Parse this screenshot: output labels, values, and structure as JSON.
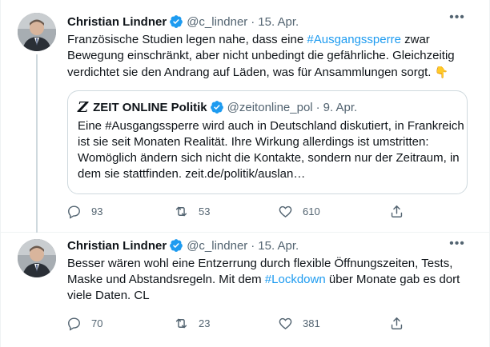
{
  "tweets": [
    {
      "author": "Christian Lindner",
      "handle": "@c_lindner",
      "separator": "·",
      "date": "15. Apr.",
      "lines": [
        {
          "pre": "Französische Studien legen nahe, dass eine ",
          "tag": "#Ausgangssperre",
          "post": " zwar"
        },
        {
          "pre": "Bewegung einschränkt, aber nicht unbedingt die gefährliche. Gleichzeitig",
          "tag": "",
          "post": ""
        },
        {
          "pre": "verdichtet sie den Andrang auf Läden, was für Ansammlungen sorgt. ",
          "tag": "",
          "post": "👇"
        }
      ],
      "quote": {
        "logo": "Z",
        "author": "ZEIT ONLINE Politik",
        "handle": "@zeitonline_pol",
        "date": "9. Apr.",
        "lines": [
          "Eine #Ausgangssperre wird auch in Deutschland diskutiert, in Frankreich",
          "ist sie seit Monaten Realität. Ihre Wirkung allerdings ist umstritten:",
          "Womöglich ändern sich nicht die Kontakte, sondern nur der Zeitraum, in",
          "dem sie stattfinden. zeit.de/politik/auslan…"
        ]
      },
      "replies": "93",
      "retweets": "53",
      "likes": "610"
    },
    {
      "author": "Christian Lindner",
      "handle": "@c_lindner",
      "separator": "·",
      "date": "15. Apr.",
      "lines": [
        {
          "pre": "Besser wären wohl eine Entzerrung durch flexible Öffnungszeiten, Tests,",
          "tag": "",
          "post": ""
        },
        {
          "pre": "Maske und Abstandsregeln. Mit dem ",
          "tag": "#Lockdown",
          "post": " über Monate gab es dort"
        },
        {
          "pre": "viele Daten. CL",
          "tag": "",
          "post": ""
        }
      ],
      "replies": "70",
      "retweets": "23",
      "likes": "381"
    }
  ],
  "colors": {
    "accent": "#1d9bf0",
    "muted": "#536471",
    "border": "#cfd9de"
  },
  "icons": [
    "verified-badge-icon",
    "more-options-icon",
    "reply-icon",
    "retweet-icon",
    "like-icon",
    "share-icon",
    "pointing-down-emoji"
  ]
}
